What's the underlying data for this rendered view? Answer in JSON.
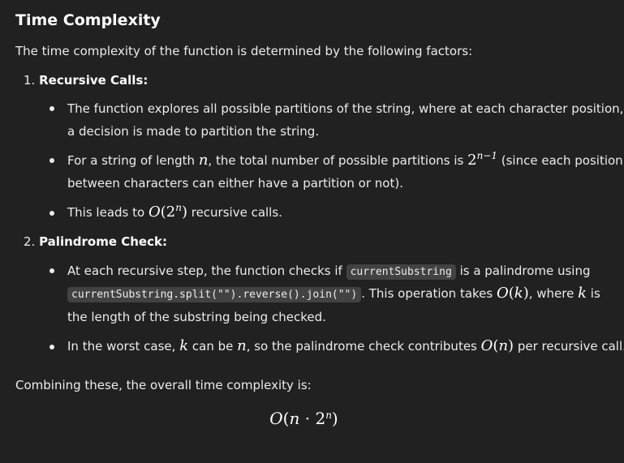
{
  "heading": "Time Complexity",
  "intro": "The time complexity of the function is determined by the following factors:",
  "section1": {
    "number": "1.",
    "title": "Recursive Calls:",
    "bullet1_line1": "The function explores all possible partitions of the string, where at each character position,",
    "bullet1_line2": "a decision is made to partition the string.",
    "bullet2_a": "For a string of length ",
    "bullet2_n": "n",
    "bullet2_b": ", the total number of possible partitions is ",
    "bullet2_base": "2",
    "bullet2_exp": "n−1",
    "bullet2_c": " (since each position",
    "bullet2_line2": "between characters can either have a partition or not).",
    "bullet3_a": "This leads to ",
    "bullet3_O": "O",
    "bullet3_open": "(2",
    "bullet3_exp": "n",
    "bullet3_close": ")",
    "bullet3_b": " recursive calls."
  },
  "section2": {
    "number": "2.",
    "title": "Palindrome Check:",
    "bullet1_a": "At each recursive step, the function checks if ",
    "bullet1_code1": "currentSubstring",
    "bullet1_b": " is a palindrome using",
    "bullet1_code2": "currentSubstring.split(\"\").reverse().join(\"\")",
    "bullet1_c": ". This operation takes ",
    "bullet1_O": "O",
    "bullet1_open": "(",
    "bullet1_k": "k",
    "bullet1_close": ")",
    "bullet1_d": ", where ",
    "bullet1_k2": "k",
    "bullet1_e": " is",
    "bullet1_line3": "the length of the substring being checked.",
    "bullet2_a": "In the worst case, ",
    "bullet2_k": "k",
    "bullet2_b": " can be ",
    "bullet2_n": "n",
    "bullet2_c": ", so the palindrome check contributes ",
    "bullet2_O": "O",
    "bullet2_open": "(",
    "bullet2_n2": "n",
    "bullet2_close": ")",
    "bullet2_d": " per recursive call."
  },
  "conclusion": "Combining these, the overall time complexity is:",
  "formula": {
    "O": "O",
    "open": "(",
    "n": "n",
    "dot": " · ",
    "base": "2",
    "exp": "n",
    "close": ")"
  }
}
